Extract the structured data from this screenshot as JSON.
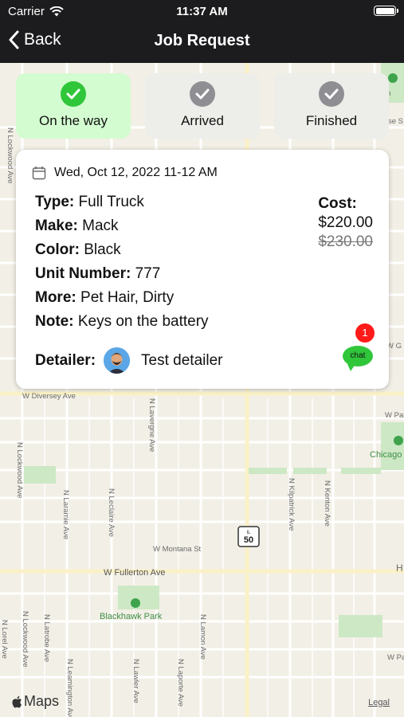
{
  "status_bar": {
    "carrier": "Carrier",
    "time": "11:37 AM"
  },
  "nav": {
    "back_label": "Back",
    "title": "Job Request"
  },
  "steps": [
    {
      "label": "On the way",
      "active": true
    },
    {
      "label": "Arrived",
      "active": false
    },
    {
      "label": "Finished",
      "active": false
    }
  ],
  "job": {
    "date": "Wed, Oct 12, 2022 11-12 AM",
    "type_label": "Type:",
    "type": "Full Truck",
    "make_label": "Make:",
    "make": "Mack",
    "color_label": "Color:",
    "color": "Black",
    "unit_label": "Unit Number:",
    "unit": "777",
    "more_label": "More:",
    "more": "Pet Hair, Dirty",
    "note_label": "Note:",
    "note": "Keys on the battery",
    "cost_label": "Cost:",
    "cost": "$220.00",
    "original_cost": "$230.00",
    "detailer_label": "Detailer:",
    "detailer_name": "Test detailer"
  },
  "chat": {
    "label": "chat",
    "unread": "1"
  },
  "map": {
    "streets": [
      "W Diversey Ave",
      "W Fullerton Ave",
      "W Montana St",
      "N Lockwood Ave",
      "N Laramie Ave",
      "N Leclaire Ave",
      "N Lavergne Ave",
      "N Kilpatrick Ave",
      "N Kenton Ave",
      "N Lorel Ave",
      "N Latrobe Ave",
      "N Leamington Ave",
      "N Lawler Ave",
      "N Laporte Ave",
      "N Lamon Ave",
      "W Palmer",
      "W Parker",
      "W G"
    ],
    "parks": [
      "Blackhawk Park",
      "Chicago Distr"
    ],
    "route_shield": "50",
    "shield_label": "IL",
    "attribution": "Maps",
    "legal": "Legal",
    "edge_labels": [
      "rn",
      "se S",
      "H"
    ]
  },
  "colors": {
    "active_step": "#d3fcd0",
    "check_active": "#30c63a",
    "check_inactive": "#8e8e93",
    "badge": "#ff1a1a"
  }
}
